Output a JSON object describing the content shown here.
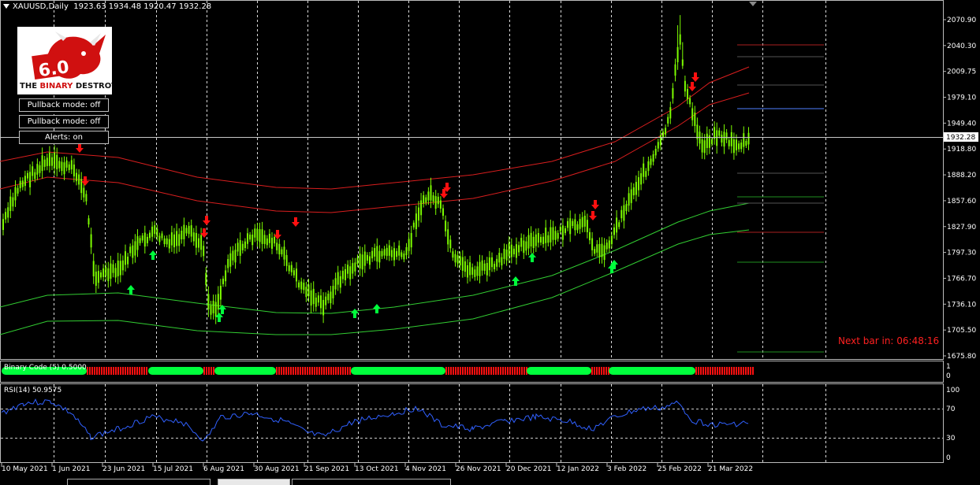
{
  "window": {
    "title": "XAUUSD,Daily",
    "ohlc": "1923.63 1934.48 1920.47 1932.28"
  },
  "logo": {
    "version": "6.0",
    "brand_left": "THE",
    "brand_mid": "BINARY",
    "brand_right": "DESTROYER"
  },
  "buttons": [
    {
      "label": "Pullback mode: off"
    },
    {
      "label": "Pullback mode: off"
    },
    {
      "label": "Alerts: on"
    }
  ],
  "price_axis": {
    "ticks": [
      "2070.90",
      "2040.30",
      "2009.75",
      "1979.10",
      "1949.40",
      "1918.80",
      "1888.20",
      "1857.60",
      "1827.90",
      "1797.30",
      "1766.70",
      "1736.10",
      "1705.50",
      "1675.80"
    ],
    "current_price": "1932.28"
  },
  "next_bar": "Next bar in: 06:48:16",
  "binary_indicator": {
    "label": "Binary Code (5) 0.5000",
    "scale": [
      "1",
      "0"
    ]
  },
  "rsi": {
    "label": "RSI(14) 50.9575",
    "scale": [
      "100",
      "70",
      "30",
      "0"
    ]
  },
  "time_axis": {
    "labels": [
      "10 May 2021",
      "1 Jun 2021",
      "23 Jun 2021",
      "15 Jul 2021",
      "6 Aug 2021",
      "30 Aug 2021",
      "21 Sep 2021",
      "13 Oct 2021",
      "4 Nov 2021",
      "26 Nov 2021",
      "20 Dec 2021",
      "12 Jan 2022",
      "3 Feb 2022",
      "25 Feb 2022",
      "21 Mar 2022"
    ]
  },
  "colors": {
    "background": "#000000",
    "bull_candle": "#7CFC00",
    "upper_band": "#d81e1e",
    "lower_band": "#32cd32",
    "signal_up": "#00ff3c",
    "signal_down": "#ff1010",
    "rsi_line": "#3060ff"
  }
}
